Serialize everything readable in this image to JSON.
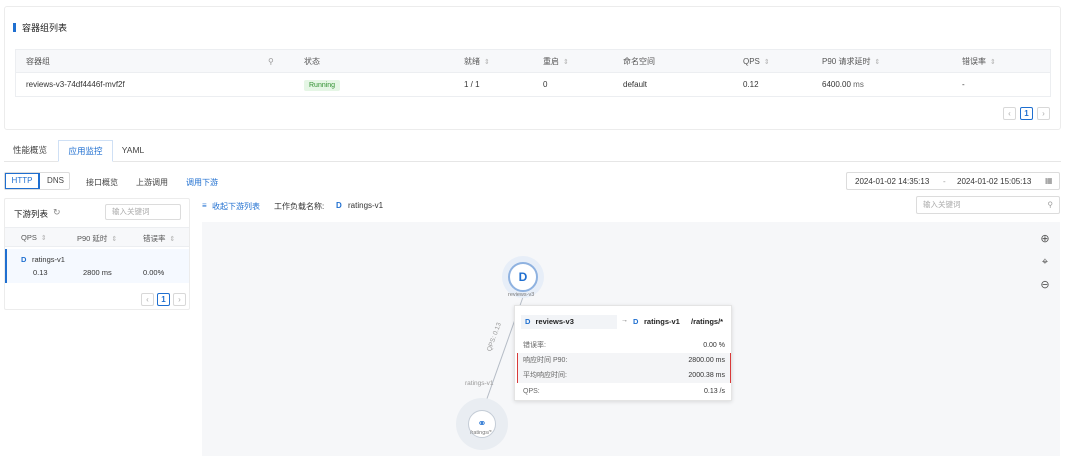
{
  "pod_section": {
    "title": "容器组列表",
    "columns": [
      "容器组",
      "状态",
      "就绪",
      "重启",
      "命名空间",
      "QPS",
      "P90 请求延时",
      "错误率"
    ],
    "rows": [
      {
        "name": "reviews-v3-74df4446f-mvf2f",
        "status": "Running",
        "ready": "1 / 1",
        "restarts": "0",
        "namespace": "default",
        "qps": "0.12",
        "p90_value": "6400.00",
        "p90_unit": "ms",
        "error_rate": "-"
      }
    ],
    "pagination": {
      "prev": "‹",
      "current": "1",
      "next": "›"
    }
  },
  "main_tabs": [
    "性能概览",
    "应用监控",
    "YAML"
  ],
  "protocol_tabs": [
    "HTTP",
    "DNS"
  ],
  "sub_tabs": [
    "接口概览",
    "上游调用",
    "调用下游"
  ],
  "date_range": {
    "start": "2024-01-02 14:35:13",
    "separator": "-",
    "end": "2024-01-02 15:05:13"
  },
  "downstream": {
    "title": "下游列表",
    "search_placeholder": "输入关键词",
    "columns": [
      "QPS",
      "P90 延时",
      "错误率"
    ],
    "rows": [
      {
        "badge": "D",
        "name": "ratings-v1",
        "qps": "0.13",
        "p90": "2800 ms",
        "error_rate": "0.00%"
      }
    ],
    "pagination": {
      "prev": "‹",
      "current": "1",
      "next": "›"
    }
  },
  "topology": {
    "collapse_label": "收起下游列表",
    "workload_label": "工作负载名称:",
    "workload_badge": "D",
    "workload_name": "ratings-v1",
    "search_placeholder": "输入关键词",
    "source_node": {
      "badge": "D",
      "label": "reviews-v3"
    },
    "target_node": {
      "label": "/ratings/*"
    },
    "edge_label": "QPS: 0.13",
    "edge_side_label": "ratings-v1",
    "tooltip": {
      "from_badge": "D",
      "from_name": "reviews-v3",
      "arrow": "→",
      "to_badge": "D",
      "to_name": "ratings-v1",
      "path": "/ratings/*",
      "rows": [
        {
          "label": "错误率:",
          "value": "0.00 %"
        },
        {
          "label": "响应时间 P90:",
          "value": "2800.00 ms"
        },
        {
          "label": "平均响应时间:",
          "value": "2000.38 ms"
        },
        {
          "label": "QPS:",
          "value": "0.13 /s"
        }
      ]
    }
  },
  "colors": {
    "accent": "#1f6fd0",
    "running_bg": "#e5f6e5",
    "running_fg": "#2f8f2f",
    "highlight": "#d83a3a"
  }
}
